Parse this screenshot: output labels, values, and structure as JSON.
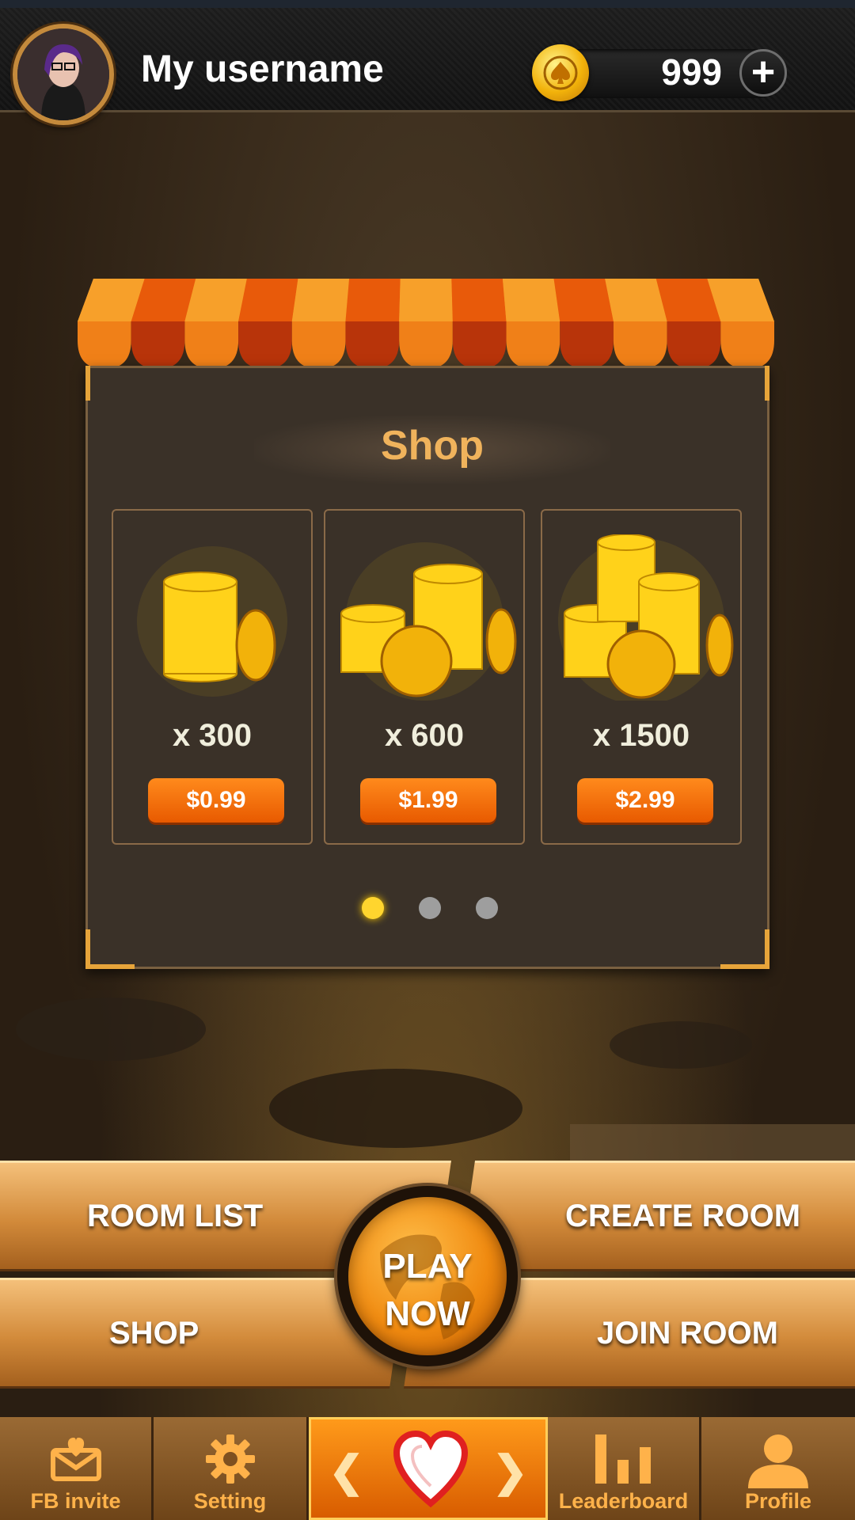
{
  "header": {
    "username": "My username",
    "coins": "999",
    "add_label": "+"
  },
  "shop": {
    "title": "Shop",
    "packs": [
      {
        "quantity": "x 300",
        "price": "$0.99"
      },
      {
        "quantity": "x 600",
        "price": "$1.99"
      },
      {
        "quantity": "x 1500",
        "price": "$2.99"
      }
    ],
    "page_count": 3,
    "active_page": 1
  },
  "actions": {
    "room_list": "ROOM LIST",
    "create_room": "CREATE ROOM",
    "shop": "SHOP",
    "join_room": "JOIN ROOM",
    "play_line1": "PLAY",
    "play_line2": "NOW"
  },
  "nav": {
    "fb_invite": "FB invite",
    "setting": "Setting",
    "prev": "❮",
    "next": "❯",
    "leaderboard": "Leaderboard",
    "profile": "Profile"
  },
  "colors": {
    "accent": "#f08a10",
    "title": "#f0b35c",
    "price_button": "#e85a00",
    "dot_active": "#ffd52e",
    "dot_inactive": "#9e9e9e"
  },
  "icons": [
    "spade-coin-icon",
    "plus-icon",
    "coin-stack-icon",
    "envelope-heart-icon",
    "gear-icon",
    "heart-icon",
    "bar-chart-icon",
    "person-icon",
    "globe-icon"
  ]
}
